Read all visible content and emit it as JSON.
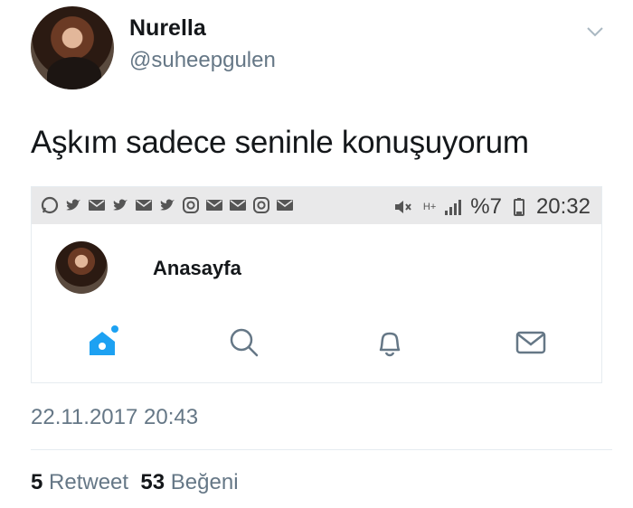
{
  "author": {
    "name": "Nurella",
    "handle": "@suheepgulen"
  },
  "tweet": {
    "text": "Aşkım sadece seninle konuşuyorum",
    "date": "22.11.2017 20:43"
  },
  "embedded_screenshot": {
    "status_bar": {
      "notification_icons": [
        "whatsapp-icon",
        "twitter-icon",
        "mail-icon",
        "twitter-icon",
        "mail-icon",
        "twitter-icon",
        "instagram-icon",
        "mail-icon",
        "mail-icon",
        "instagram-icon",
        "mail-icon"
      ],
      "network": "H+",
      "battery": "%7",
      "time": "20:32"
    },
    "page_title": "Anasayfa",
    "tabs": [
      "home-icon",
      "search-icon",
      "notifications-icon",
      "messages-icon"
    ],
    "accent_color": "#1da1f2"
  },
  "stats": {
    "retweets_count": "5",
    "retweets_label": "Retweet",
    "likes_count": "53",
    "likes_label": "Beğeni"
  }
}
